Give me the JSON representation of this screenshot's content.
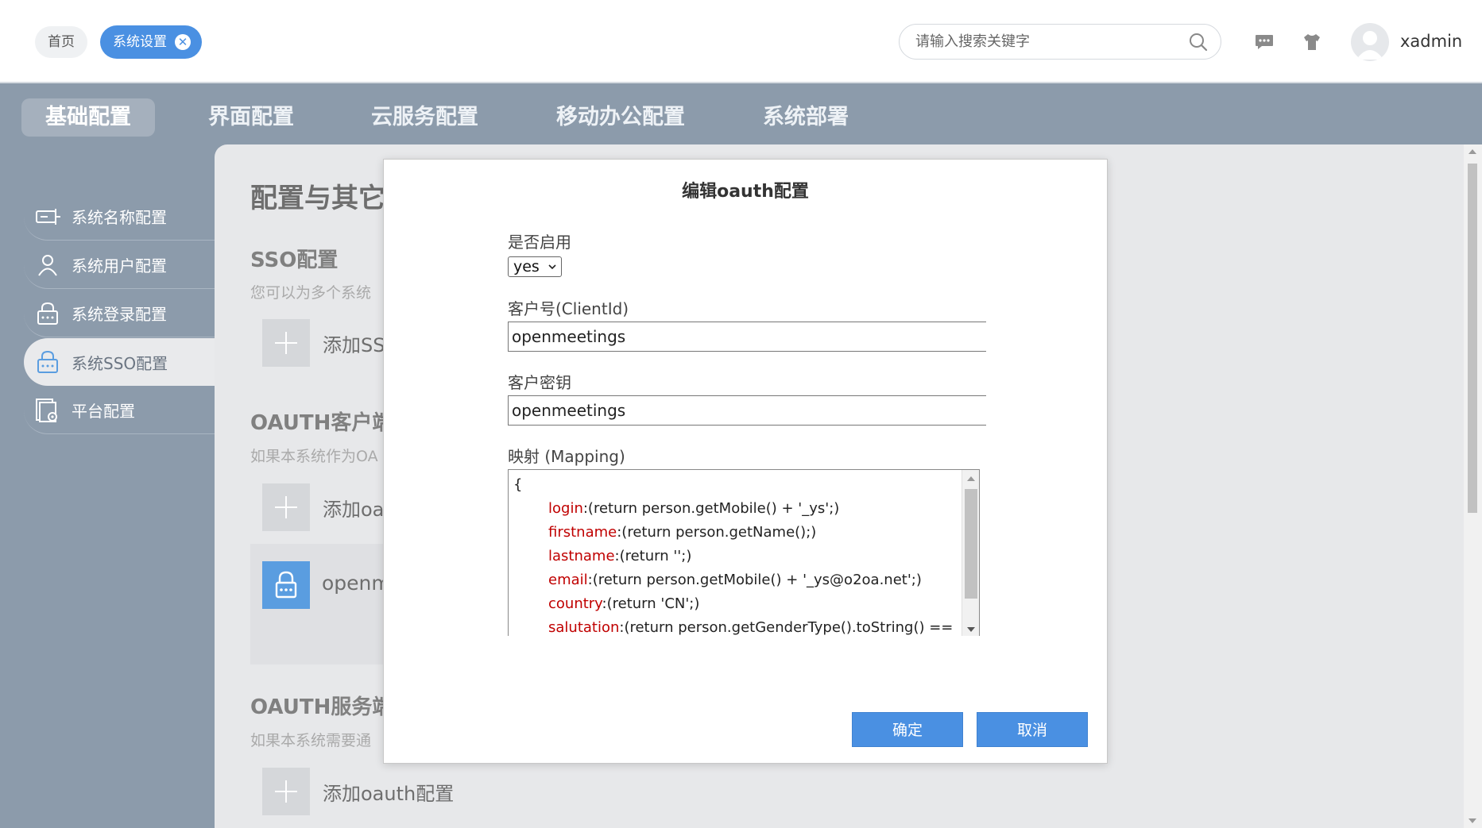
{
  "header": {
    "tabs": [
      {
        "label": "首页"
      },
      {
        "label": "系统设置",
        "close_glyph": "✕"
      }
    ],
    "search_placeholder": "请输入搜索关键字",
    "icons": [
      "search-icon",
      "chat-icon",
      "shirt-icon"
    ],
    "username": "xadmin"
  },
  "nav": {
    "items": [
      {
        "label": "基础配置",
        "active": true
      },
      {
        "label": "界面配置"
      },
      {
        "label": "云服务配置"
      },
      {
        "label": "移动办公配置"
      },
      {
        "label": "系统部署"
      }
    ]
  },
  "sidebar": {
    "items": [
      {
        "label": "系统名称配置",
        "icon": "name-tag-icon"
      },
      {
        "label": "系统用户配置",
        "icon": "user-icon"
      },
      {
        "label": "系统登录配置",
        "icon": "lock-icon"
      },
      {
        "label": "系统SSO配置",
        "icon": "lock-icon",
        "active": true
      },
      {
        "label": "平台配置",
        "icon": "platform-settings-icon"
      }
    ]
  },
  "content": {
    "title": "配置与其它",
    "sso": {
      "heading": "SSO配置",
      "desc": "您可以为多个系统",
      "add_label": "添加SSO"
    },
    "oauth_client": {
      "heading": "OAUTH客户端",
      "desc": "如果本系统作为OA",
      "add_label": "添加oa",
      "card_label": "openm"
    },
    "oauth_server": {
      "heading": "OAUTH服务端",
      "desc": "如果本系统需要通",
      "add_label": "添加oauth配置"
    }
  },
  "modal": {
    "title": "编辑oauth配置",
    "enable_label": "是否启用",
    "enable_value": "yes",
    "client_id_label": "客户号(ClientId)",
    "client_id_value": "openmeetings",
    "secret_label": "客户密钥",
    "secret_value": "openmeetings",
    "mapping_label": "映射 (Mapping)",
    "mapping_open": "{",
    "mapping": [
      {
        "key": "login",
        "value": ":(return person.getMobile() + '_ys';)"
      },
      {
        "key": "firstname",
        "value": ":(return person.getName();)"
      },
      {
        "key": "lastname",
        "value": ":(return '';)"
      },
      {
        "key": "email",
        "value": ":(return person.getMobile() + '_ys@o2oa.net';)"
      },
      {
        "key": "country",
        "value": ":(return 'CN';)"
      },
      {
        "key": "salutation",
        "value": ":(return person.getGenderType().toString() =="
      }
    ],
    "confirm_label": "确定",
    "cancel_label": "取消"
  },
  "colors": {
    "accent": "#4a90e2",
    "backdrop": "#8c9bab",
    "mapping_key": "#c00000"
  }
}
